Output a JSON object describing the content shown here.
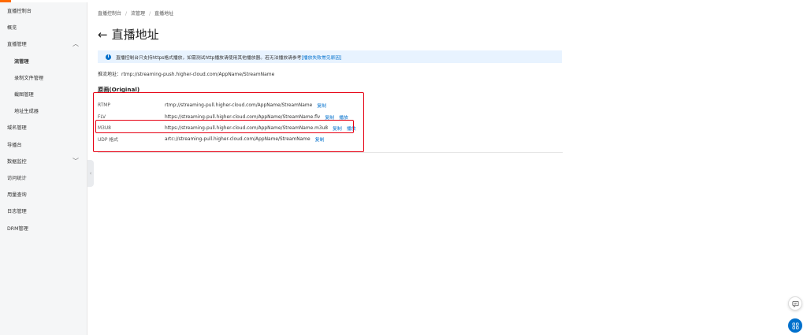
{
  "sidebar": {
    "items": [
      {
        "label": "直播控制台",
        "type": "header"
      },
      {
        "label": "概览",
        "type": "item"
      },
      {
        "label": "直播管理",
        "type": "group",
        "chevron": "chevron-up-icon"
      },
      {
        "label": "流管理",
        "type": "sub",
        "active": true
      },
      {
        "label": "录制文件管理",
        "type": "sub"
      },
      {
        "label": "截图管理",
        "type": "sub"
      },
      {
        "label": "地址生成器",
        "type": "sub"
      },
      {
        "label": "域名管理",
        "type": "item"
      },
      {
        "label": "导播台",
        "type": "item"
      },
      {
        "label": "数据监控",
        "type": "group",
        "chevron": "chevron-down-icon"
      },
      {
        "label": "访问统计",
        "type": "item"
      },
      {
        "label": "用量查询",
        "type": "item"
      },
      {
        "label": "日志管理",
        "type": "item"
      },
      {
        "label": "DRM管理",
        "type": "item"
      }
    ],
    "collapse_glyph": "‹"
  },
  "breadcrumb": [
    "直播控制台",
    "流管理",
    "直播地址"
  ],
  "page": {
    "back_glyph": "←",
    "title": "直播地址"
  },
  "notice": {
    "icon": "i",
    "text": "直播控制台只支持https格式播放，如需测试http播放请使用其他播放器。若无法播放请参考",
    "link": "[播放失败常见原因]"
  },
  "push": {
    "label": "推流地址：",
    "url": "rtmp://streaming-push.higher-cloud.com/AppName/StreamName"
  },
  "section": {
    "title": "原画(Original)"
  },
  "rows": [
    {
      "protocol": "RTMP",
      "url": "rtmp://streaming-pull.higher-cloud.com/AppName/StreamName",
      "actions": [
        "复制"
      ]
    },
    {
      "protocol": "FLV",
      "url": "https://streaming-pull.higher-cloud.com/AppName/StreamName.flv",
      "actions": [
        "复制",
        "播放"
      ]
    },
    {
      "protocol": "M3U8",
      "url": "https://streaming-pull.higher-cloud.com/AppName/StreamName.m3u8",
      "actions": [
        "复制",
        "播放"
      ]
    },
    {
      "protocol": "UDP 格式",
      "url": "artc://streaming-pull.higher-cloud.com/AppName/StreamName",
      "actions": [
        "复制"
      ]
    }
  ],
  "colors": {
    "accent": "#ff6a00",
    "link": "#0070cc",
    "highlight": "#e60012",
    "notice_bg": "#e8f3ff"
  }
}
